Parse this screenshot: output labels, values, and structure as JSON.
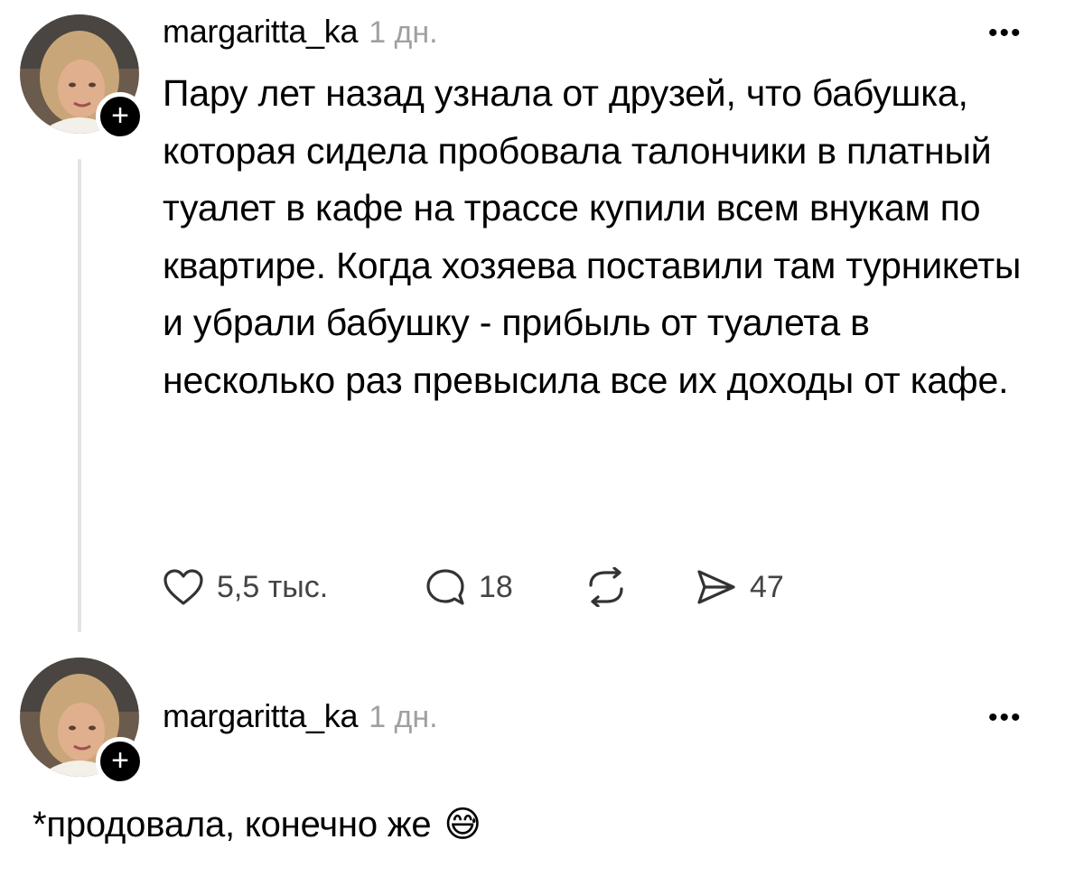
{
  "post": {
    "username": "margaritta_ka",
    "time": "1 дн.",
    "more": "•••",
    "text": "Пару лет назад узнала от друзей, что бабушка, которая сидела пробовала талончики в платный туалет в кафе на трассе купили всем внукам по квартире. Когда хозяева поставили там турникеты и убрали бабушку - прибыль от туалета в несколько раз превысила все их доходы от кафе.",
    "likes": "5,5 тыс.",
    "comments": "18",
    "shares": "47"
  },
  "reply": {
    "username": "margaritta_ka",
    "time": "1 дн.",
    "more": "•••",
    "text": "*продовала, конечно же",
    "emoji": "😅"
  },
  "icons": {
    "heart": "heart-icon",
    "comment": "comment-icon",
    "repost": "repost-icon",
    "share": "share-icon",
    "follow": "plus-icon"
  },
  "colors": {
    "text": "#000000",
    "muted": "#a0a0a0",
    "thread_line": "#e3e3e3"
  }
}
